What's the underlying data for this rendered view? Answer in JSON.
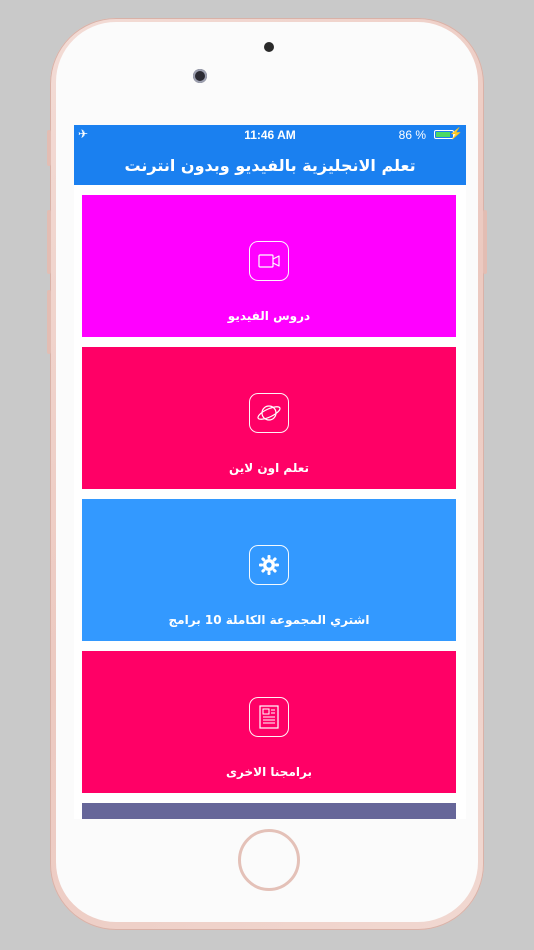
{
  "colors": {
    "nav": "#1a80f0",
    "tile_video": "#ff00ff",
    "tile_online": "#ff0066",
    "tile_buy": "#3399ff",
    "tile_apps": "#ff0066",
    "bottom_strip": "#666699"
  },
  "status_bar": {
    "airplane_icon": "✈",
    "time": "11:46 AM",
    "battery_percent": "86 %",
    "battery_level": 0.86,
    "charging_icon": "⚡"
  },
  "header": {
    "title": "تعلم الانجليزية بالفيديو وبدون انترنت"
  },
  "tiles": [
    {
      "label": "دروس الفيديو",
      "icon": "video-camera-icon"
    },
    {
      "label": "تعلم اون لاين",
      "icon": "planet-icon"
    },
    {
      "label": "اشتري المجموعة الكاملة 10 برامج",
      "icon": "gear-icon"
    },
    {
      "label": "برامجنا الاخرى",
      "icon": "document-icon"
    }
  ]
}
